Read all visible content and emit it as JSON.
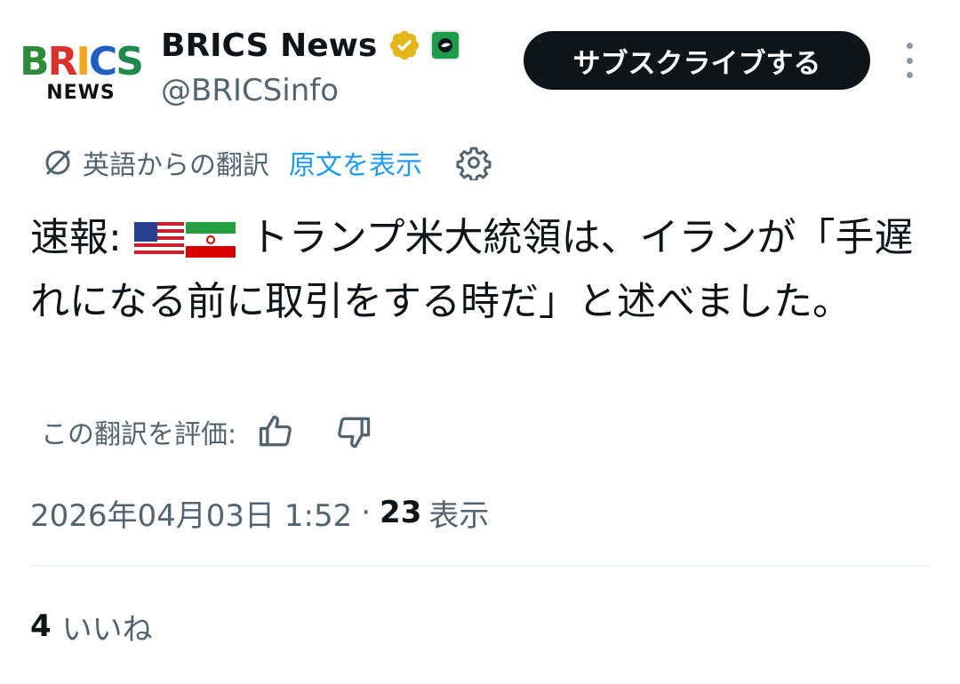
{
  "account": {
    "logo_text_top": "BRICS",
    "logo_text_bottom": "NEWS",
    "display_name": "BRICS News",
    "handle": "@BRICSinfo",
    "verified_icon": "gold-verified-badge-icon",
    "affiliate_icon": "affiliate-badge-icon"
  },
  "header": {
    "subscribe_label": "サブスクライブする",
    "more_icon": "vertical-dots-icon"
  },
  "translation": {
    "label": "英語からの翻訳",
    "show_original": "原文を表示",
    "icon": "translate-icon",
    "settings_icon": "gear-icon"
  },
  "tweet": {
    "lead": "速報: ",
    "flags": [
      "us-flag-icon",
      "iran-flag-icon"
    ],
    "body": " トランプ米大統領は、イランが「手遅れになる前に取引をする時だ」と述べました。"
  },
  "rating": {
    "label": "この翻訳を評価:",
    "up_icon": "thumbs-up-icon",
    "down_icon": "thumbs-down-icon"
  },
  "meta": {
    "timestamp": "2026年04月03日 1:52",
    "separator": "·",
    "views_count": "23",
    "views_label": "表示"
  },
  "stats": {
    "likes_count": "4",
    "likes_label": "いいね"
  },
  "colors": {
    "text": "#0f1419",
    "secondary": "#536471",
    "link": "#1d9bf0",
    "button_bg": "#0f1419",
    "verified_gold": "#e2b719"
  }
}
